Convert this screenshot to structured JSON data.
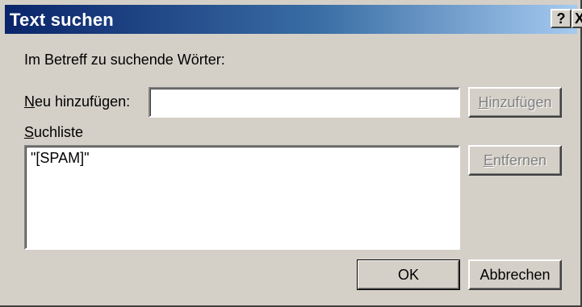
{
  "window": {
    "title": "Text suchen",
    "help_glyph": "?",
    "close_glyph": "X"
  },
  "instructions": "Im Betreff zu suchende Wörter:",
  "new_field": {
    "label_mnemonic": "N",
    "label_rest": "eu hinzufügen:",
    "value": ""
  },
  "add_button": {
    "mnemonic": "H",
    "rest": "inzufügen",
    "enabled": false
  },
  "search_list": {
    "label_mnemonic": "S",
    "label_rest": "uchliste",
    "items": [
      "\"[SPAM]\""
    ]
  },
  "remove_button": {
    "mnemonic": "E",
    "rest": "ntfernen",
    "enabled": false
  },
  "ok_button": {
    "label": "OK"
  },
  "cancel_button": {
    "label": "Abbrechen"
  }
}
